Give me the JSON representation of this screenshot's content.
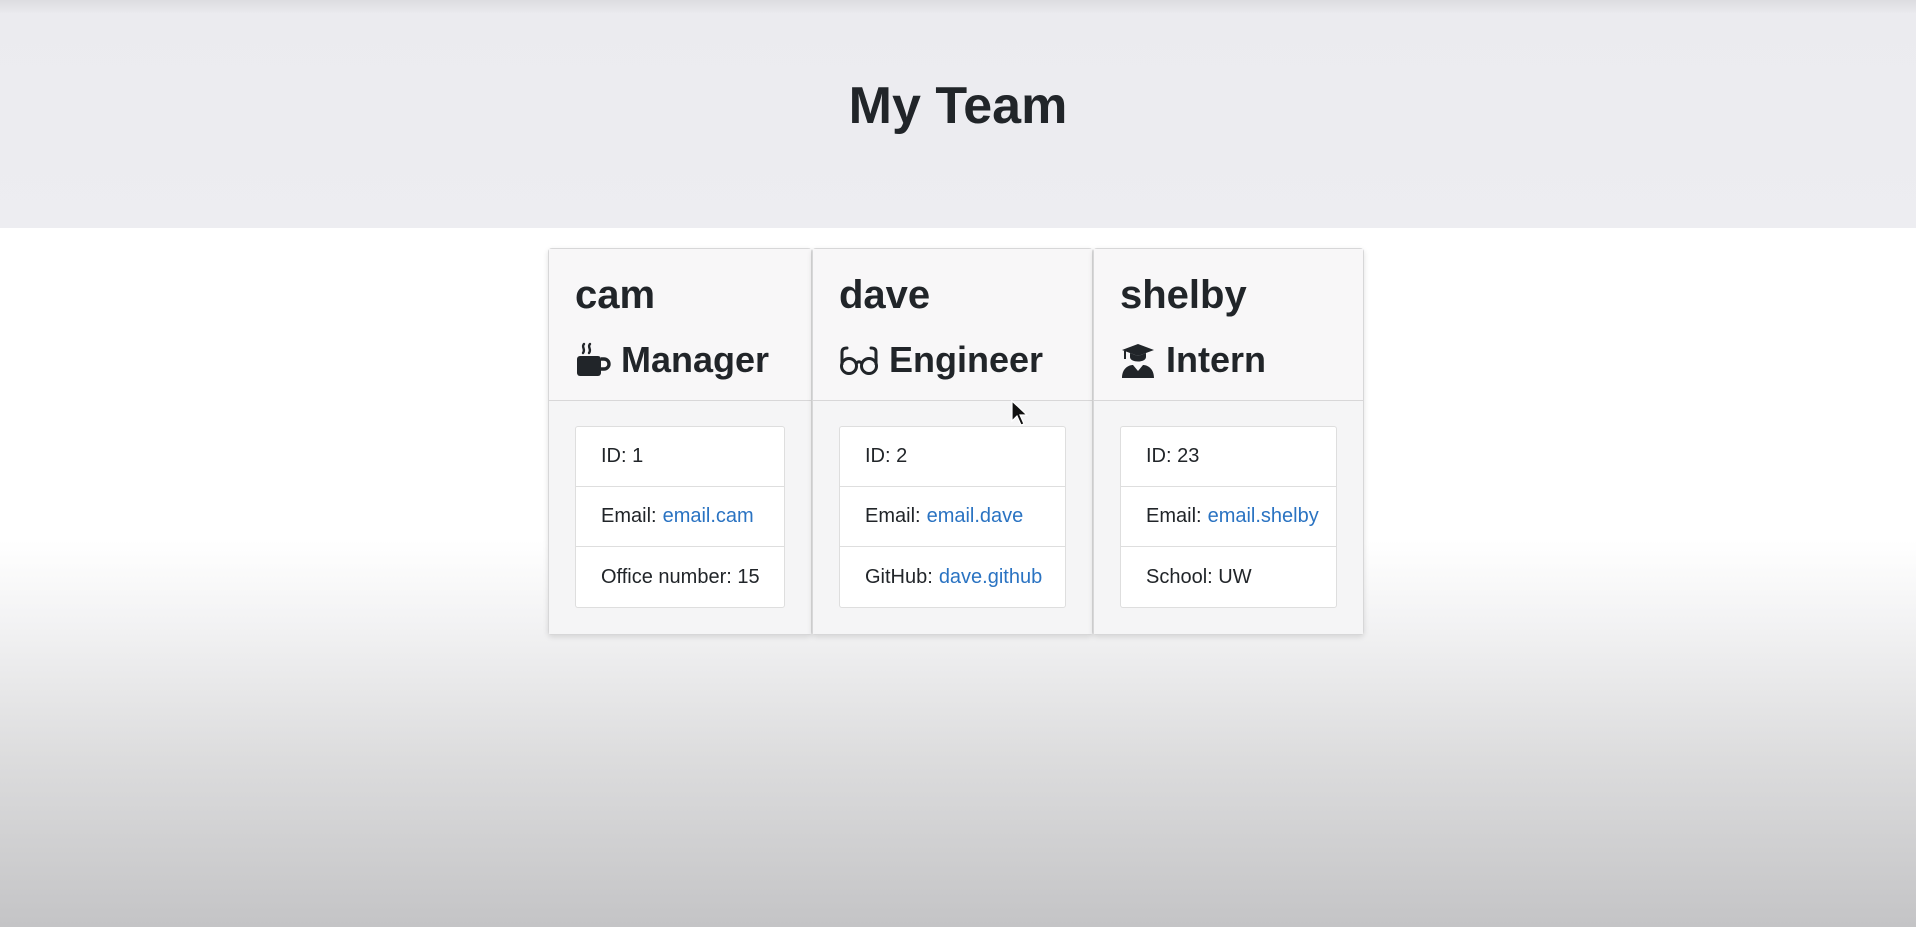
{
  "header": {
    "title": "My Team"
  },
  "team": [
    {
      "name": "cam",
      "role": "Manager",
      "icon": "mug-icon",
      "id_label": "ID:",
      "id": "1",
      "email_label": "Email:",
      "email": "email.cam",
      "extra_label": "Office number:",
      "extra": "15"
    },
    {
      "name": "dave",
      "role": "Engineer",
      "icon": "glasses-icon",
      "id_label": "ID:",
      "id": "2",
      "email_label": "Email:",
      "email": "email.dave",
      "extra_label": "GitHub:",
      "extra": "dave.github"
    },
    {
      "name": "shelby",
      "role": "Intern",
      "icon": "graduate-icon",
      "id_label": "ID:",
      "id": "23",
      "email_label": "Email:",
      "email": "email.shelby",
      "extra_label": "School:",
      "extra": "UW"
    }
  ],
  "colors": {
    "link": "#2a73c2",
    "header_bg": "#ededf1",
    "text": "#212529"
  }
}
